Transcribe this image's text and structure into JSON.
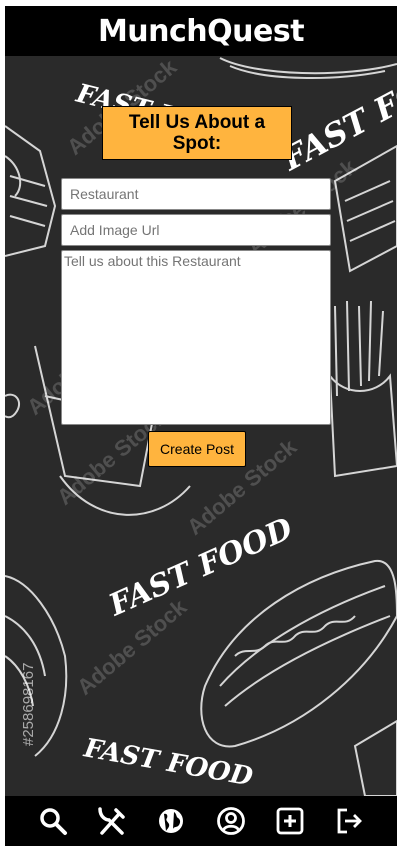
{
  "header": {
    "title": "MunchQuest"
  },
  "form": {
    "heading": "Tell Us About a Spot:",
    "restaurant_placeholder": "Restaurant",
    "image_placeholder": "Add Image Url",
    "description_placeholder": "Tell us about this Restaurant",
    "submit_label": "Create Post"
  },
  "background": {
    "texts": [
      "FAST FOOD",
      "FAST FOOD",
      "FAST FOOD",
      "FAST FOOD",
      "Adobe Stock",
      "Adobe Stock",
      "Adobe Stock",
      "Adobe Stock",
      "Adobe Stock",
      "Adobe Stock",
      "#258698167"
    ]
  },
  "nav": {
    "items": [
      {
        "icon": "search-icon"
      },
      {
        "icon": "utensils-icon"
      },
      {
        "icon": "globe-icon"
      },
      {
        "icon": "user-icon"
      },
      {
        "icon": "plus-square-icon"
      },
      {
        "icon": "logout-icon"
      }
    ]
  },
  "colors": {
    "accent": "#ffb43e",
    "header": "#000000",
    "background": "#2a2a2a"
  }
}
